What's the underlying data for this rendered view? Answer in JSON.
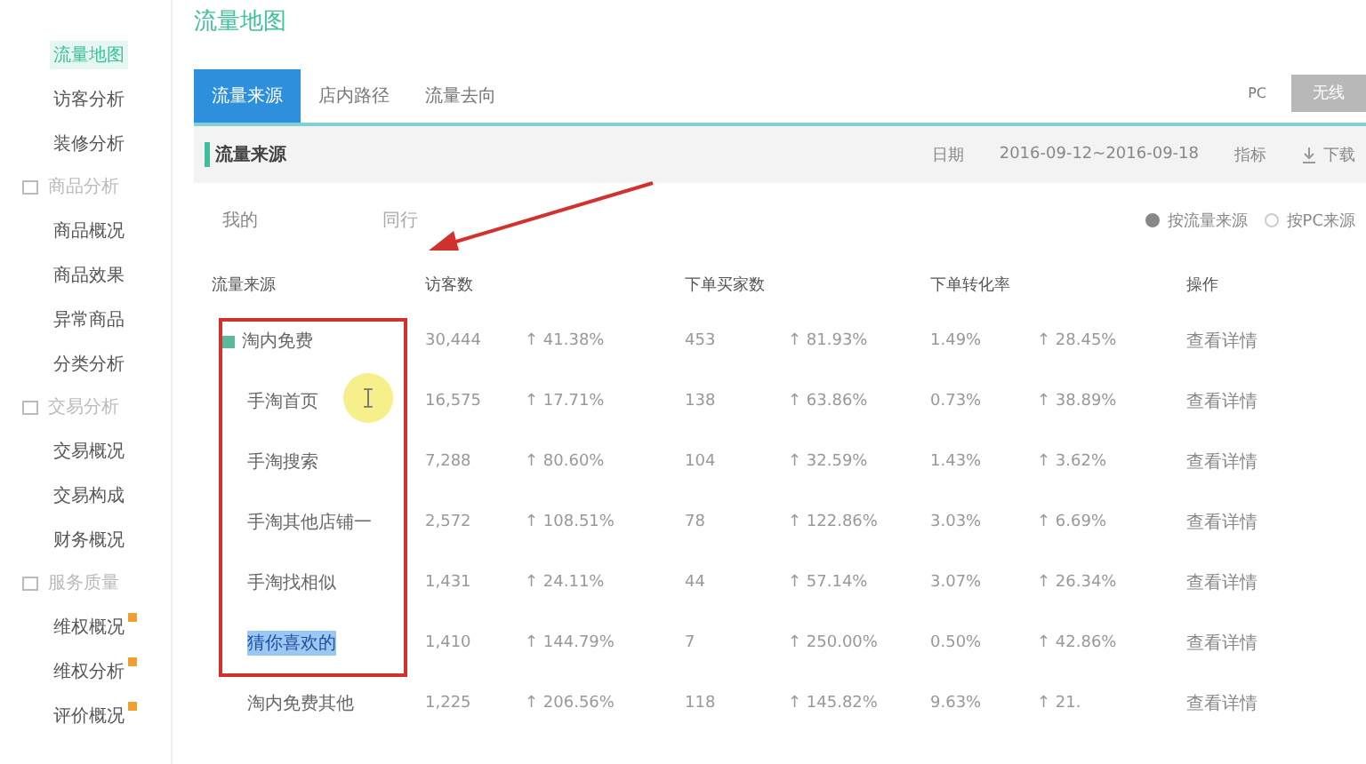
{
  "sidebar": [
    {
      "kind": "item",
      "label": "流量地图",
      "selected": true,
      "badge": false
    },
    {
      "kind": "item",
      "label": "访客分析",
      "selected": false,
      "badge": false
    },
    {
      "kind": "item",
      "label": "装修分析",
      "selected": false,
      "badge": false
    },
    {
      "kind": "group",
      "label": "商品分析"
    },
    {
      "kind": "item",
      "label": "商品概况",
      "selected": false,
      "badge": false
    },
    {
      "kind": "item",
      "label": "商品效果",
      "selected": false,
      "badge": false
    },
    {
      "kind": "item",
      "label": "异常商品",
      "selected": false,
      "badge": false
    },
    {
      "kind": "item",
      "label": "分类分析",
      "selected": false,
      "badge": false
    },
    {
      "kind": "group",
      "label": "交易分析"
    },
    {
      "kind": "item",
      "label": "交易概况",
      "selected": false,
      "badge": false
    },
    {
      "kind": "item",
      "label": "交易构成",
      "selected": false,
      "badge": false
    },
    {
      "kind": "item",
      "label": "财务概况",
      "selected": false,
      "badge": false
    },
    {
      "kind": "group",
      "label": "服务质量"
    },
    {
      "kind": "item",
      "label": "维权概况",
      "selected": false,
      "badge": true
    },
    {
      "kind": "item",
      "label": "维权分析",
      "selected": false,
      "badge": true
    },
    {
      "kind": "item",
      "label": "评价概况",
      "selected": false,
      "badge": true
    }
  ],
  "page_title": "流量地图",
  "tabs": [
    {
      "label": "流量来源",
      "selected": true
    },
    {
      "label": "店内路径",
      "selected": false
    },
    {
      "label": "流量去向",
      "selected": false
    }
  ],
  "device": {
    "label": "PC",
    "button": "无线"
  },
  "section": {
    "title": "流量来源",
    "date_label": "日期",
    "date": "2016-09-12~2016-09-18",
    "metric": "指标",
    "download": "下载"
  },
  "subtabs": [
    {
      "label": "我的",
      "selected": true
    },
    {
      "label": "同行",
      "selected": false
    }
  ],
  "options": [
    {
      "label": "按流量来源",
      "selected": true
    },
    {
      "label": "按PC来源",
      "selected": false
    }
  ],
  "table": {
    "columns": [
      "流量来源",
      "访客数",
      "下单买家数",
      "下单转化率",
      "操作"
    ],
    "rows": [
      {
        "source": "淘内免费",
        "expandable": true,
        "highlighted": false,
        "visitors": "30,444",
        "visitors_change": "↑ 41.38%",
        "buyers": "453",
        "buyers_change": "↑ 81.93%",
        "rate": "1.49%",
        "rate_change": "↑ 28.45%",
        "action": "查看详情"
      },
      {
        "source": "手淘首页",
        "expandable": false,
        "highlighted": false,
        "visitors": "16,575",
        "visitors_change": "↑ 17.71%",
        "buyers": "138",
        "buyers_change": "↑ 63.86%",
        "rate": "0.73%",
        "rate_change": "↑ 38.89%",
        "action": "查看详情"
      },
      {
        "source": "手淘搜索",
        "expandable": false,
        "highlighted": false,
        "visitors": "7,288",
        "visitors_change": "↑ 80.60%",
        "buyers": "104",
        "buyers_change": "↑ 32.59%",
        "rate": "1.43%",
        "rate_change": "↑ 3.62%",
        "action": "查看详情"
      },
      {
        "source": "手淘其他店铺一",
        "expandable": false,
        "highlighted": false,
        "visitors": "2,572",
        "visitors_change": "↑ 108.51%",
        "buyers": "78",
        "buyers_change": "↑ 122.86%",
        "rate": "3.03%",
        "rate_change": "↑ 6.69%",
        "action": "查看详情"
      },
      {
        "source": "手淘找相似",
        "expandable": false,
        "highlighted": false,
        "visitors": "1,431",
        "visitors_change": "↑ 24.11%",
        "buyers": "44",
        "buyers_change": "↑ 57.14%",
        "rate": "3.07%",
        "rate_change": "↑ 26.34%",
        "action": "查看详情"
      },
      {
        "source": "猜你喜欢的",
        "expandable": false,
        "highlighted": true,
        "visitors": "1,410",
        "visitors_change": "↑ 144.79%",
        "buyers": "7",
        "buyers_change": "↑ 250.00%",
        "rate": "0.50%",
        "rate_change": "↑ 42.86%",
        "action": "查看详情"
      },
      {
        "source": "淘内免费其他",
        "expandable": false,
        "highlighted": false,
        "visitors": "1,225",
        "visitors_change": "↑ 206.56%",
        "buyers": "118",
        "buyers_change": "↑ 145.82%",
        "rate": "9.63%",
        "rate_change": "↑ 21.",
        "action": "查看详情"
      }
    ]
  }
}
